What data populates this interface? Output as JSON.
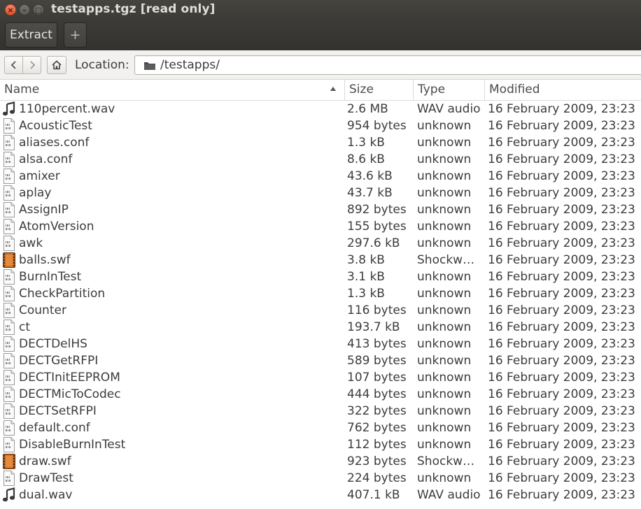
{
  "window": {
    "title": "testapps.tgz [read only]",
    "controls": {
      "close": "×",
      "minimize": "–",
      "maximize": "□"
    }
  },
  "toolbar": {
    "extract_label": "Extract",
    "add_label": "+"
  },
  "locationbar": {
    "label": "Location:",
    "path": "/testapps/"
  },
  "columns": {
    "name": "Name",
    "size": "Size",
    "type": "Type",
    "modified": "Modified"
  },
  "sort": {
    "column": "name",
    "direction": "ascending"
  },
  "icons": {
    "audio": "music-note-icon",
    "binary": "binary-file-icon",
    "video": "film-strip-icon",
    "folder": "folder-icon",
    "home": "home-icon",
    "back": "chevron-left-icon",
    "forward": "chevron-right-icon"
  },
  "colors": {
    "titlebar": "#3c3b37",
    "close_button": "#e1532d",
    "text": "#3c3c3c"
  },
  "files": [
    {
      "kind": "audio",
      "name": "110percent.wav",
      "size": "2.6 MB",
      "type": "WAV audio",
      "modified": "16 February 2009, 23:23"
    },
    {
      "kind": "binary",
      "name": "AcousticTest",
      "size": "954 bytes",
      "type": "unknown",
      "modified": "16 February 2009, 23:23"
    },
    {
      "kind": "binary",
      "name": "aliases.conf",
      "size": "1.3 kB",
      "type": "unknown",
      "modified": "16 February 2009, 23:23"
    },
    {
      "kind": "binary",
      "name": "alsa.conf",
      "size": "8.6 kB",
      "type": "unknown",
      "modified": "16 February 2009, 23:23"
    },
    {
      "kind": "binary",
      "name": "amixer",
      "size": "43.6 kB",
      "type": "unknown",
      "modified": "16 February 2009, 23:23"
    },
    {
      "kind": "binary",
      "name": "aplay",
      "size": "43.7 kB",
      "type": "unknown",
      "modified": "16 February 2009, 23:23"
    },
    {
      "kind": "binary",
      "name": "AssignIP",
      "size": "892 bytes",
      "type": "unknown",
      "modified": "16 February 2009, 23:23"
    },
    {
      "kind": "binary",
      "name": "AtomVersion",
      "size": "155 bytes",
      "type": "unknown",
      "modified": "16 February 2009, 23:23"
    },
    {
      "kind": "binary",
      "name": "awk",
      "size": "297.6 kB",
      "type": "unknown",
      "modified": "16 February 2009, 23:23"
    },
    {
      "kind": "video",
      "name": "balls.swf",
      "size": "3.8 kB",
      "type": "Shockwa…",
      "modified": "16 February 2009, 23:23"
    },
    {
      "kind": "binary",
      "name": "BurnInTest",
      "size": "3.1 kB",
      "type": "unknown",
      "modified": "16 February 2009, 23:23"
    },
    {
      "kind": "binary",
      "name": "CheckPartition",
      "size": "1.3 kB",
      "type": "unknown",
      "modified": "16 February 2009, 23:23"
    },
    {
      "kind": "binary",
      "name": "Counter",
      "size": "116 bytes",
      "type": "unknown",
      "modified": "16 February 2009, 23:23"
    },
    {
      "kind": "binary",
      "name": "ct",
      "size": "193.7 kB",
      "type": "unknown",
      "modified": "16 February 2009, 23:23"
    },
    {
      "kind": "binary",
      "name": "DECTDelHS",
      "size": "413 bytes",
      "type": "unknown",
      "modified": "16 February 2009, 23:23"
    },
    {
      "kind": "binary",
      "name": "DECTGetRFPI",
      "size": "589 bytes",
      "type": "unknown",
      "modified": "16 February 2009, 23:23"
    },
    {
      "kind": "binary",
      "name": "DECTInitEEPROM",
      "size": "107 bytes",
      "type": "unknown",
      "modified": "16 February 2009, 23:23"
    },
    {
      "kind": "binary",
      "name": "DECTMicToCodec",
      "size": "444 bytes",
      "type": "unknown",
      "modified": "16 February 2009, 23:23"
    },
    {
      "kind": "binary",
      "name": "DECTSetRFPI",
      "size": "322 bytes",
      "type": "unknown",
      "modified": "16 February 2009, 23:23"
    },
    {
      "kind": "binary",
      "name": "default.conf",
      "size": "762 bytes",
      "type": "unknown",
      "modified": "16 February 2009, 23:23"
    },
    {
      "kind": "binary",
      "name": "DisableBurnInTest",
      "size": "112 bytes",
      "type": "unknown",
      "modified": "16 February 2009, 23:23"
    },
    {
      "kind": "video",
      "name": "draw.swf",
      "size": "923 bytes",
      "type": "Shockwa…",
      "modified": "16 February 2009, 23:23"
    },
    {
      "kind": "binary",
      "name": "DrawTest",
      "size": "224 bytes",
      "type": "unknown",
      "modified": "16 February 2009, 23:23"
    },
    {
      "kind": "audio",
      "name": "dual.wav",
      "size": "407.1 kB",
      "type": "WAV audio",
      "modified": "16 February 2009, 23:23"
    }
  ]
}
